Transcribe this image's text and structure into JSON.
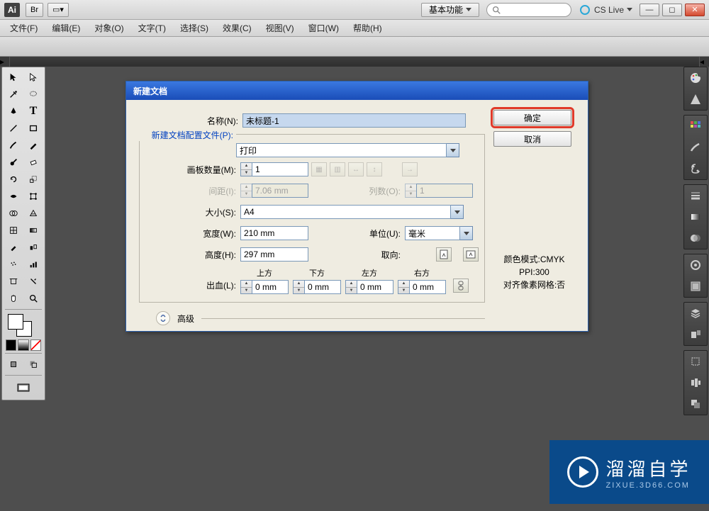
{
  "titlebar": {
    "logo": "Ai",
    "workspace": "基本功能",
    "cslive": "CS Live"
  },
  "menubar": {
    "items": [
      "文件(F)",
      "编辑(E)",
      "对象(O)",
      "文字(T)",
      "选择(S)",
      "效果(C)",
      "视图(V)",
      "窗口(W)",
      "帮助(H)"
    ]
  },
  "dialog": {
    "title": "新建文档",
    "name_label": "名称(N):",
    "name_value": "未标题-1",
    "profile_label": "新建文档配置文件(P):",
    "profile_value": "打印",
    "artboards_label": "画板数量(M):",
    "artboards_value": "1",
    "spacing_label": "间距(I):",
    "spacing_value": "7.06 mm",
    "cols_label": "列数(O):",
    "cols_value": "1",
    "size_label": "大小(S):",
    "size_value": "A4",
    "width_label": "宽度(W):",
    "width_value": "210 mm",
    "height_label": "高度(H):",
    "height_value": "297 mm",
    "unit_label": "单位(U):",
    "unit_value": "毫米",
    "orient_label": "取向:",
    "bleed_label": "出血(L):",
    "bleed_top": "上方",
    "bleed_bottom": "下方",
    "bleed_left": "左方",
    "bleed_right": "右方",
    "bleed_value": "0 mm",
    "advanced": "高级",
    "ok": "确定",
    "cancel": "取消",
    "info_colormode": "颜色模式:CMYK",
    "info_ppi": "PPI:300",
    "info_grid": "对齐像素网格:否"
  },
  "watermark": {
    "big": "溜溜自学",
    "small": "ZIXUE.3D66.COM"
  }
}
